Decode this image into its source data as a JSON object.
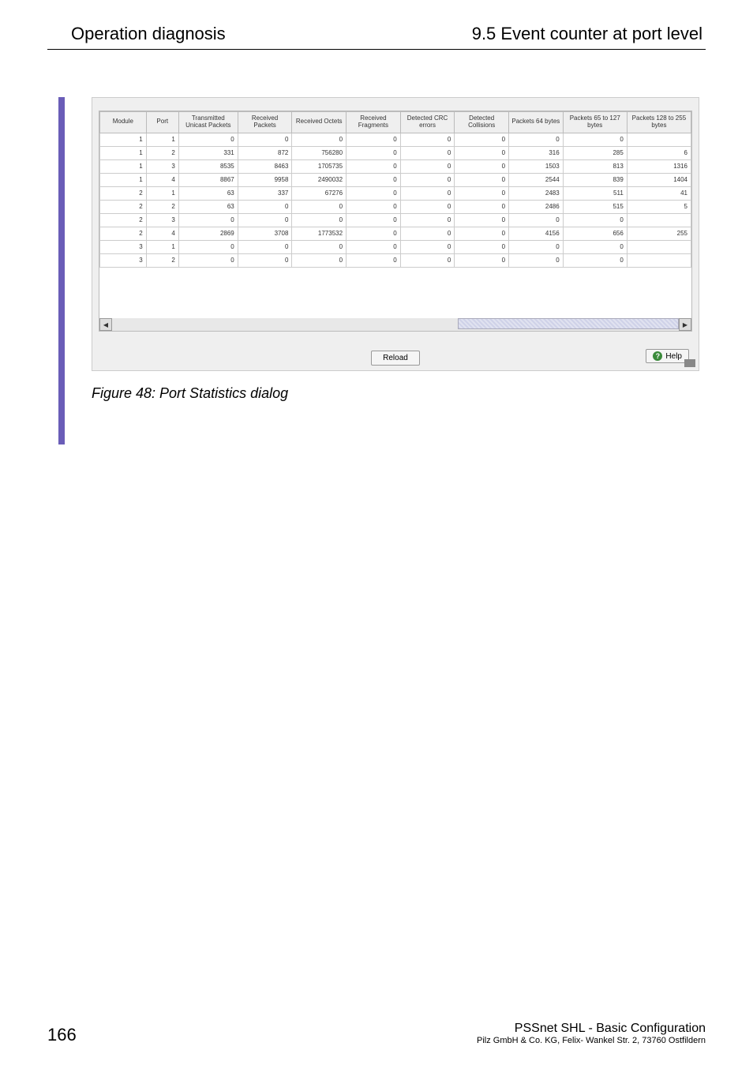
{
  "header": {
    "left": "Operation diagnosis",
    "right": "9.5  Event counter at port level"
  },
  "dialog": {
    "columns": [
      "Module",
      "Port",
      "Transmitted Unicast Packets",
      "Received Packets",
      "Received Octets",
      "Received Fragments",
      "Detected CRC errors",
      "Detected Collisions",
      "Packets 64 bytes",
      "Packets 65 to 127 bytes",
      "Packets 128 to 255 bytes"
    ],
    "rows": [
      {
        "module": "1",
        "port": "1",
        "tup": "0",
        "rp": "0",
        "ro": "0",
        "rf": "0",
        "crc": "0",
        "coll": "0",
        "p64": "0",
        "p65": "0",
        "p128": ""
      },
      {
        "module": "1",
        "port": "2",
        "tup": "331",
        "rp": "872",
        "ro": "756280",
        "rf": "0",
        "crc": "0",
        "coll": "0",
        "p64": "316",
        "p65": "285",
        "p128": "6"
      },
      {
        "module": "1",
        "port": "3",
        "tup": "8535",
        "rp": "8463",
        "ro": "1705735",
        "rf": "0",
        "crc": "0",
        "coll": "0",
        "p64": "1503",
        "p65": "813",
        "p128": "1316"
      },
      {
        "module": "1",
        "port": "4",
        "tup": "8867",
        "rp": "9958",
        "ro": "2490032",
        "rf": "0",
        "crc": "0",
        "coll": "0",
        "p64": "2544",
        "p65": "839",
        "p128": "1404"
      },
      {
        "module": "2",
        "port": "1",
        "tup": "63",
        "rp": "337",
        "ro": "67276",
        "rf": "0",
        "crc": "0",
        "coll": "0",
        "p64": "2483",
        "p65": "511",
        "p128": "41"
      },
      {
        "module": "2",
        "port": "2",
        "tup": "63",
        "rp": "0",
        "ro": "0",
        "rf": "0",
        "crc": "0",
        "coll": "0",
        "p64": "2486",
        "p65": "515",
        "p128": "5"
      },
      {
        "module": "2",
        "port": "3",
        "tup": "0",
        "rp": "0",
        "ro": "0",
        "rf": "0",
        "crc": "0",
        "coll": "0",
        "p64": "0",
        "p65": "0",
        "p128": ""
      },
      {
        "module": "2",
        "port": "4",
        "tup": "2869",
        "rp": "3708",
        "ro": "1773532",
        "rf": "0",
        "crc": "0",
        "coll": "0",
        "p64": "4156",
        "p65": "656",
        "p128": "255"
      },
      {
        "module": "3",
        "port": "1",
        "tup": "0",
        "rp": "0",
        "ro": "0",
        "rf": "0",
        "crc": "0",
        "coll": "0",
        "p64": "0",
        "p65": "0",
        "p128": ""
      },
      {
        "module": "3",
        "port": "2",
        "tup": "0",
        "rp": "0",
        "ro": "0",
        "rf": "0",
        "crc": "0",
        "coll": "0",
        "p64": "0",
        "p65": "0",
        "p128": ""
      }
    ],
    "reload_label": "Reload",
    "help_label": "Help"
  },
  "caption": "Figure 48: Port Statistics dialog",
  "footer": {
    "page_number": "166",
    "title": "PSSnet SHL - Basic Configuration",
    "sub": "Pilz GmbH & Co. KG, Felix- Wankel Str. 2, 73760 Ostfildern"
  }
}
